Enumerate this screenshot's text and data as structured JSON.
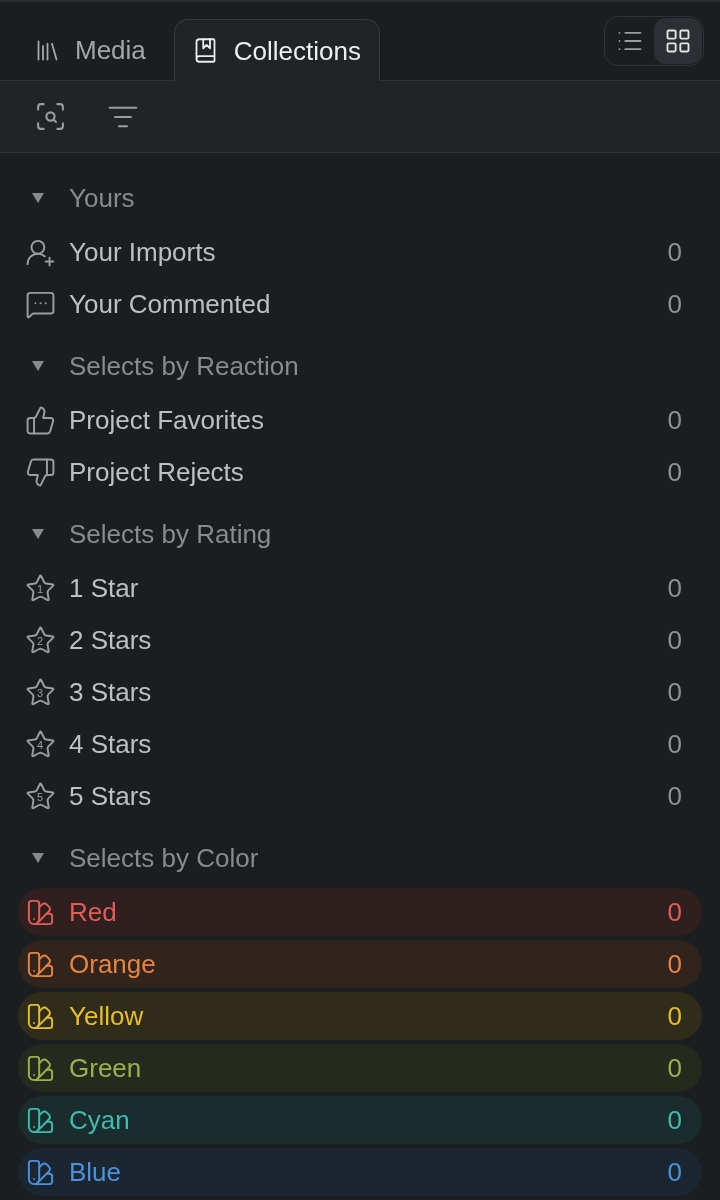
{
  "tabs": [
    {
      "kind": "media",
      "label": "Media",
      "selected": false
    },
    {
      "kind": "collections",
      "label": "Collections",
      "selected": true
    }
  ],
  "view_toggle": [
    {
      "kind": "list",
      "selected": false
    },
    {
      "kind": "grid",
      "selected": true
    }
  ],
  "sections": [
    {
      "title": "Yours",
      "expanded": true,
      "items": [
        {
          "kind": "imports",
          "label": "Your Imports",
          "count": "0"
        },
        {
          "kind": "comments",
          "label": "Your Commented",
          "count": "0"
        }
      ]
    },
    {
      "title": "Selects by Reaction",
      "expanded": true,
      "items": [
        {
          "kind": "favorites",
          "label": "Project Favorites",
          "count": "0"
        },
        {
          "kind": "rejects",
          "label": "Project Rejects",
          "count": "0"
        }
      ]
    },
    {
      "title": "Selects by Rating",
      "expanded": true,
      "items": [
        {
          "kind": "rating",
          "badge": "1",
          "label": "1 Star",
          "count": "0"
        },
        {
          "kind": "rating",
          "badge": "2",
          "label": "2 Stars",
          "count": "0"
        },
        {
          "kind": "rating",
          "badge": "3",
          "label": "3 Stars",
          "count": "0"
        },
        {
          "kind": "rating",
          "badge": "4",
          "label": "4 Stars",
          "count": "0"
        },
        {
          "kind": "rating",
          "badge": "5",
          "label": "5 Stars",
          "count": "0"
        }
      ]
    },
    {
      "title": "Selects by Color",
      "expanded": true,
      "items": [
        {
          "kind": "color",
          "color": "#e35d57",
          "label": "Red",
          "count": "0"
        },
        {
          "kind": "color",
          "color": "#e8843f",
          "label": "Orange",
          "count": "0"
        },
        {
          "kind": "color",
          "color": "#e6be2a",
          "label": "Yellow",
          "count": "0"
        },
        {
          "kind": "color",
          "color": "#9cb04c",
          "label": "Green",
          "count": "0"
        },
        {
          "kind": "color",
          "color": "#3fbcb2",
          "label": "Cyan",
          "count": "0"
        },
        {
          "kind": "color",
          "color": "#4a92dc",
          "label": "Blue",
          "count": "0"
        }
      ]
    }
  ]
}
